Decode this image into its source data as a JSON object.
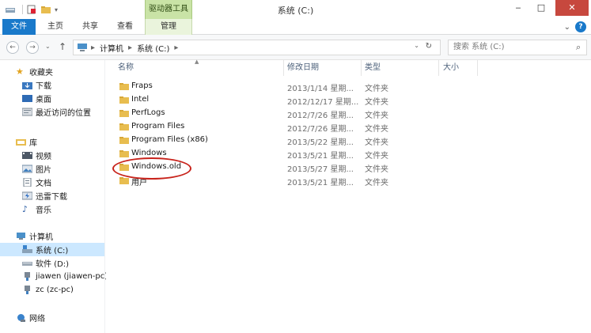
{
  "titlebar": {
    "tools_tab": "驱动器工具",
    "title": "系统 (C:)",
    "minimize": "‒",
    "maximize": "□",
    "close": "✕"
  },
  "ribbon": {
    "tabs": [
      "文件",
      "主页",
      "共享",
      "查看",
      "管理"
    ],
    "expand": "⌄",
    "help": "?"
  },
  "address": {
    "back": "←",
    "forward": "→",
    "history": "⌄",
    "up": "↑",
    "crumbs": [
      "计算机",
      "系统 (C:)"
    ],
    "sep": "▸",
    "dropdown": "⌄",
    "refresh": "↻"
  },
  "search": {
    "placeholder": "搜索 系统 (C:)",
    "icon": "search-icon"
  },
  "navpane": {
    "favorites": {
      "label": "收藏夹",
      "items": [
        "下载",
        "桌面",
        "最近访问的位置"
      ]
    },
    "libraries": {
      "label": "库",
      "items": [
        "视频",
        "图片",
        "文档",
        "迅雷下载",
        "音乐"
      ]
    },
    "computer": {
      "label": "计算机",
      "items": [
        "系统 (C:)",
        "软件 (D:)",
        "jiawen (jiawen-pc)",
        "zc (zc-pc)"
      ]
    },
    "network": {
      "label": "网络"
    }
  },
  "columns": [
    "名称",
    "修改日期",
    "类型",
    "大小"
  ],
  "files": [
    {
      "name": "Fraps",
      "date": "2013/1/14 星期...",
      "type": "文件夹"
    },
    {
      "name": "Intel",
      "date": "2012/12/17 星期...",
      "type": "文件夹"
    },
    {
      "name": "PerfLogs",
      "date": "2012/7/26 星期...",
      "type": "文件夹"
    },
    {
      "name": "Program Files",
      "date": "2012/7/26 星期...",
      "type": "文件夹"
    },
    {
      "name": "Program Files (x86)",
      "date": "2013/5/22 星期...",
      "type": "文件夹"
    },
    {
      "name": "Windows",
      "date": "2013/5/21 星期...",
      "type": "文件夹"
    },
    {
      "name": "Windows.old",
      "date": "2013/5/27 星期...",
      "type": "文件夹"
    },
    {
      "name": "用户",
      "date": "2013/5/21 星期...",
      "type": "文件夹"
    }
  ],
  "colors": {
    "accent": "#1979ca",
    "tools_tab": "#c9e3a6",
    "close": "#c7483e",
    "highlight": "#c8231b",
    "folder": "#e8bd4f",
    "selection": "#cce8ff"
  }
}
